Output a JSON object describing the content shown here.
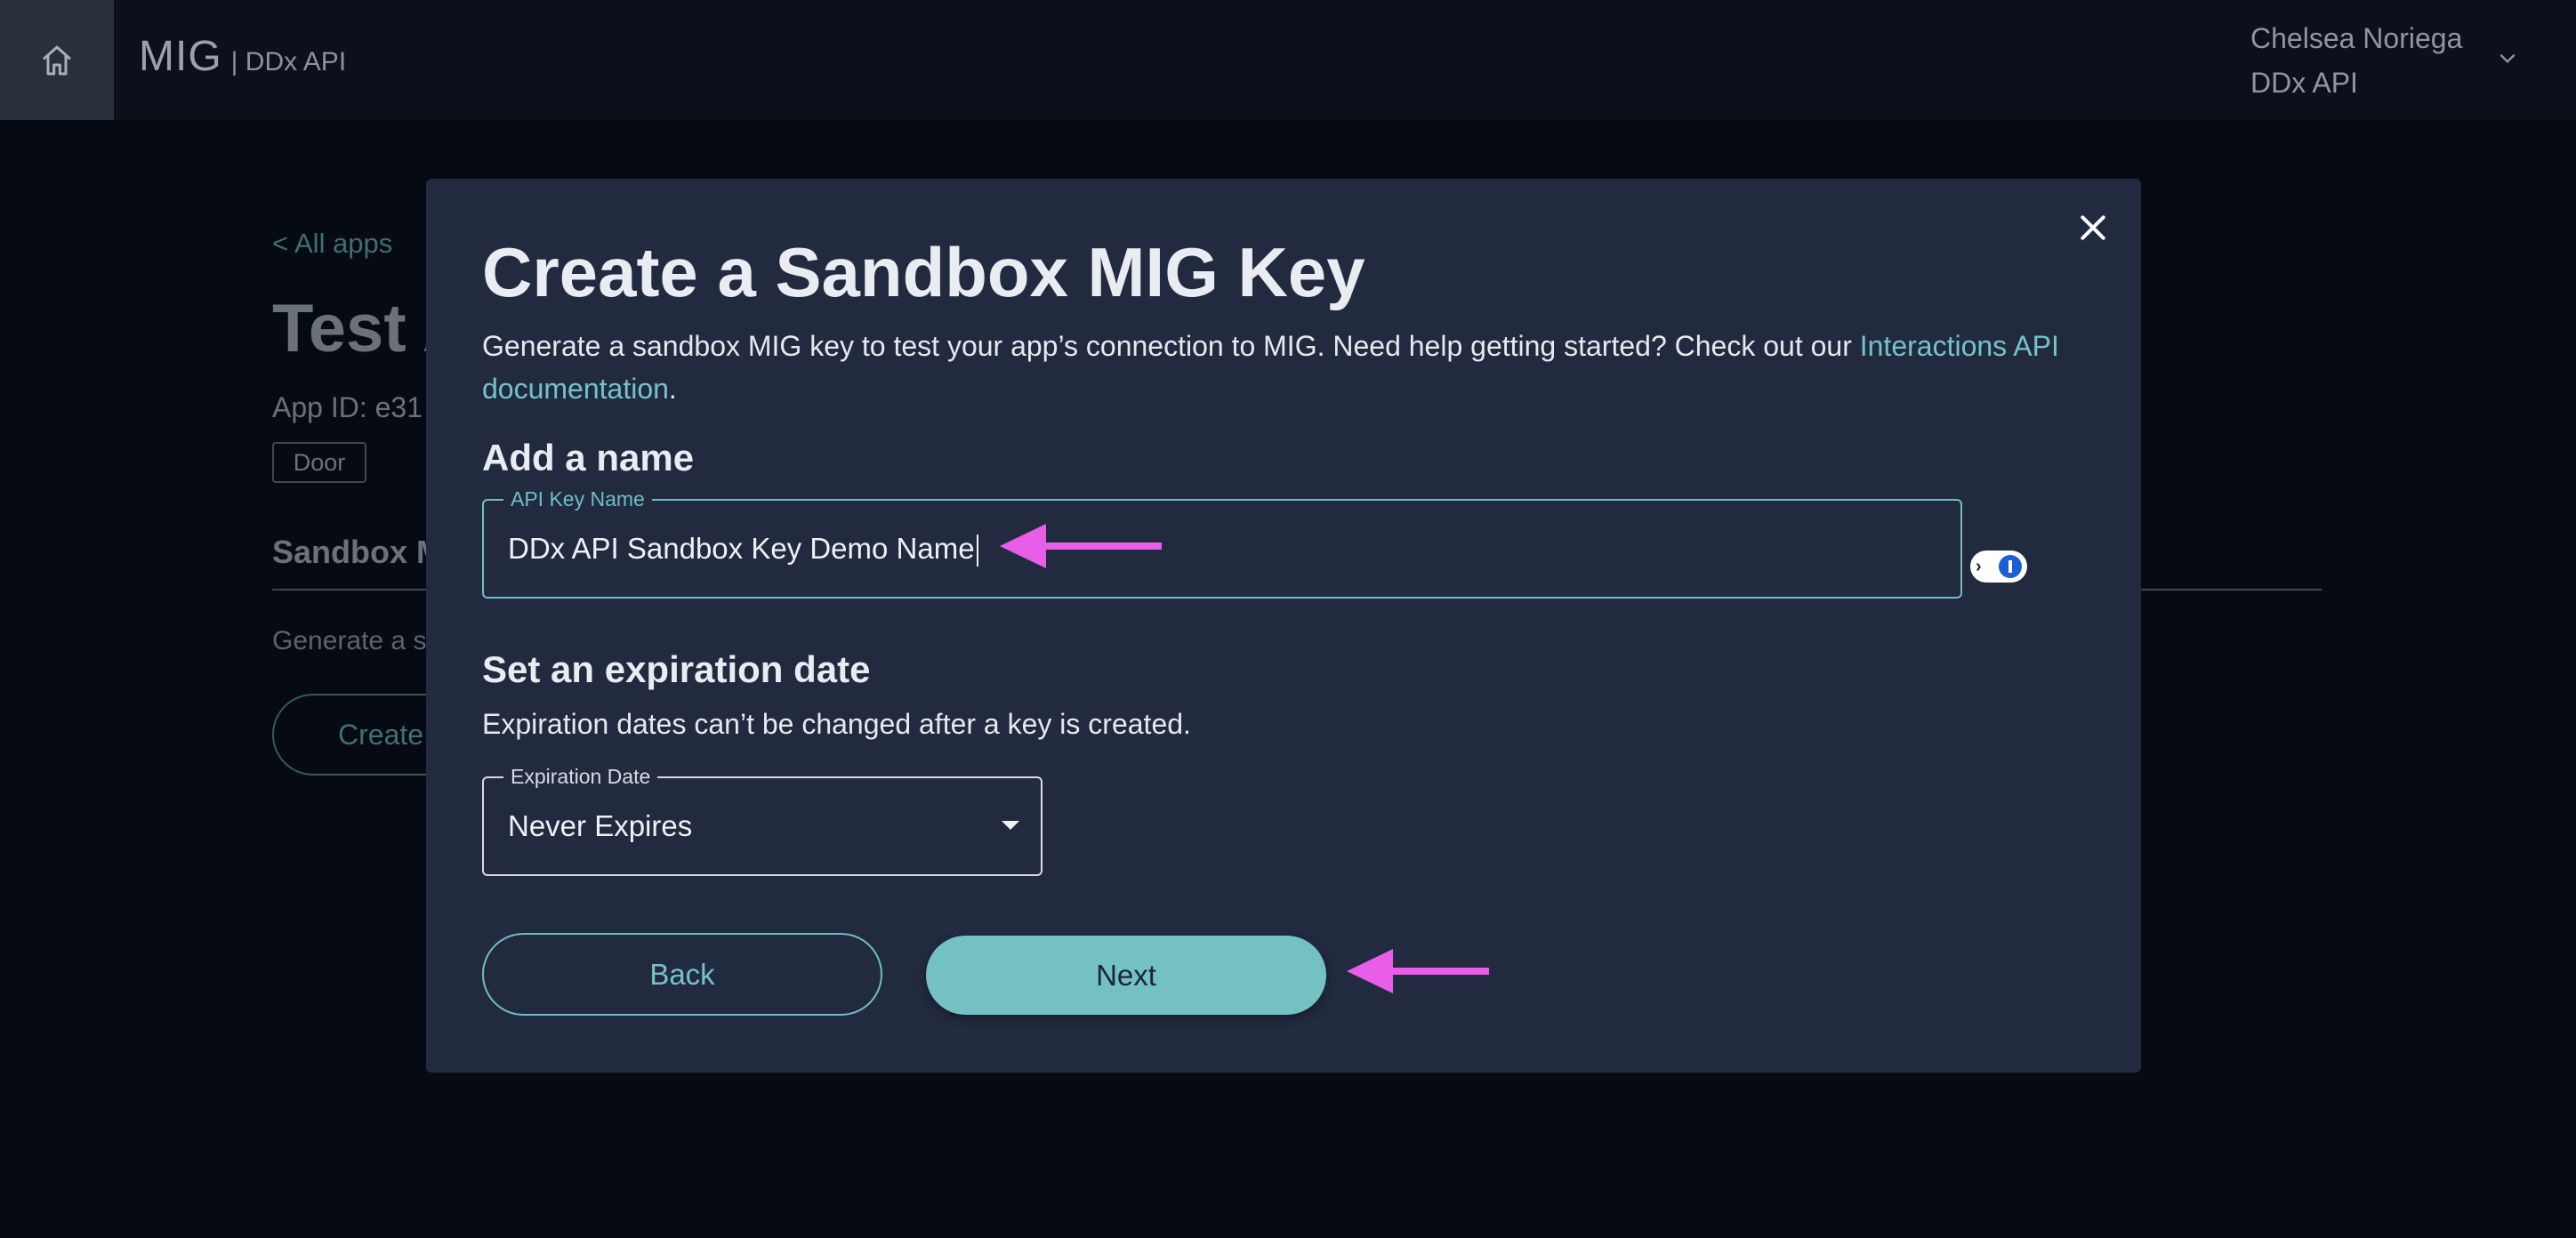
{
  "header": {
    "brand": "MIG",
    "brand_sub": "| DDx API",
    "user_name": "Chelsea Noriega",
    "user_org": "DDx API"
  },
  "background": {
    "back_link": "< All apps",
    "title": "Test A",
    "app_id": "App ID: e31",
    "tag": "Door",
    "section_title": "Sandbox M",
    "generate_text": "Generate a s",
    "create_button": "Create"
  },
  "modal": {
    "title": "Create a Sandbox MIG Key",
    "description": "Generate a sandbox MIG key to test your app’s connection to MIG. Need help getting started? Check out our ",
    "doc_link": "Interactions API documentation",
    "description_end": ".",
    "name_heading": "Add a name",
    "name_field": {
      "label": "API Key Name",
      "value": "DDx API Sandbox Key Demo Name"
    },
    "exp_heading": "Set an expiration date",
    "exp_description": "Expiration dates can’t be changed after a key is created.",
    "exp_field": {
      "label": "Expiration Date",
      "value": "Never Expires"
    },
    "back_button": "Back",
    "next_button": "Next"
  },
  "colors": {
    "accent": "#74c1c4",
    "annotation_arrow": "#e85ee8",
    "modal_bg": "#222a40"
  }
}
